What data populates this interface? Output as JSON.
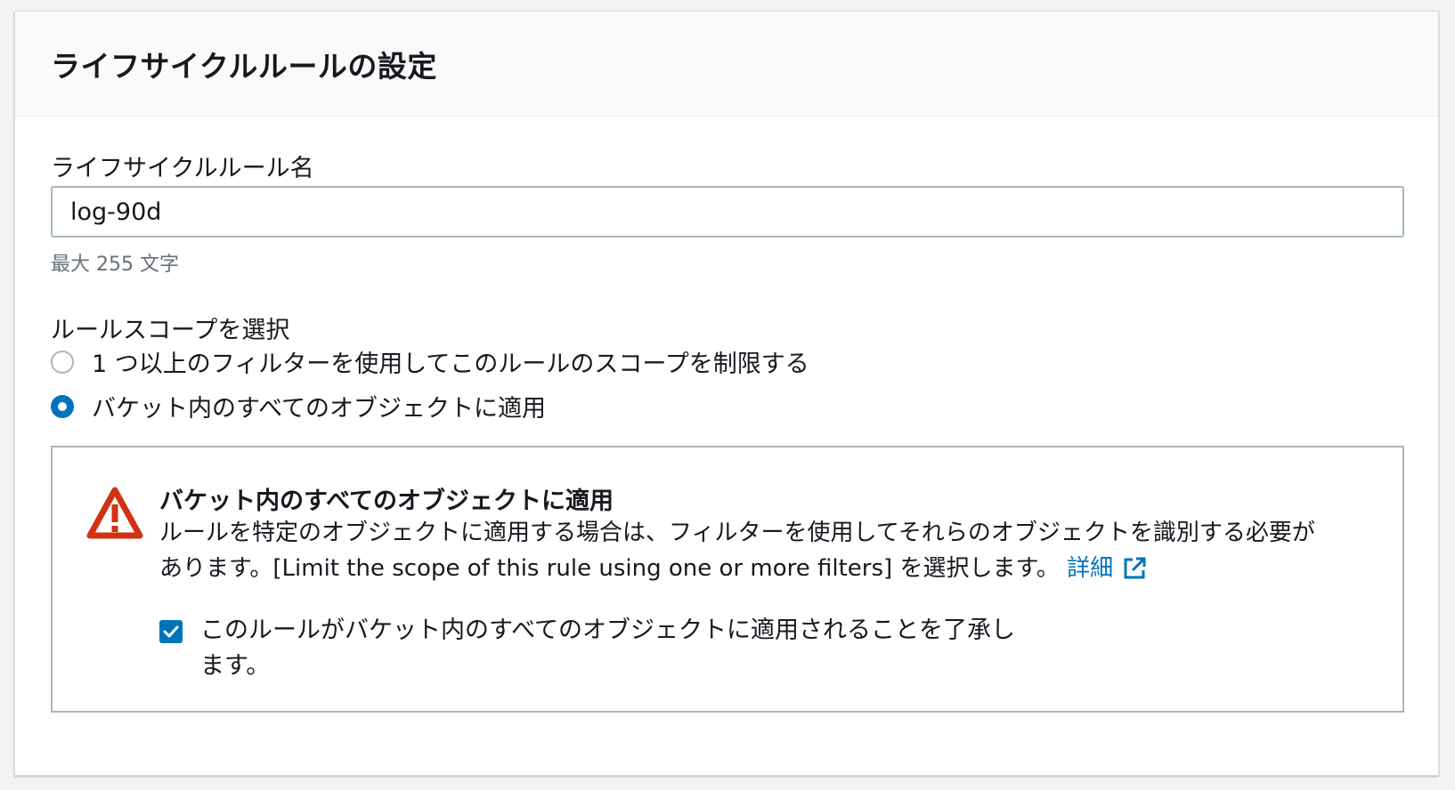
{
  "header": {
    "title": "ライフサイクルルールの設定"
  },
  "rule_name": {
    "label": "ライフサイクルルール名",
    "value": "log-90d",
    "constraint": "最大 255 文字"
  },
  "scope": {
    "label": "ルールスコープを選択",
    "options": [
      {
        "label": "1 つ以上のフィルターを使用してこのルールのスコープを制限する",
        "selected": false
      },
      {
        "label": "バケット内のすべてのオブジェクトに適用",
        "selected": true
      }
    ]
  },
  "warning": {
    "icon": "warning-icon",
    "title": "バケット内のすべてのオブジェクトに適用",
    "body": "ルールを特定のオブジェクトに適用する場合は、フィルターを使用してそれらのオブジェクトを識別する必要があります。[Limit the scope of this rule using one or more filters] を選択します。",
    "learn_more": "詳細",
    "acknowledge_label": "このルールがバケット内のすべてのオブジェクトに適用されることを了承します。",
    "acknowledged": true
  },
  "colors": {
    "accent": "#0073bb",
    "warning": "#d13212",
    "border": "#aab7b8"
  }
}
